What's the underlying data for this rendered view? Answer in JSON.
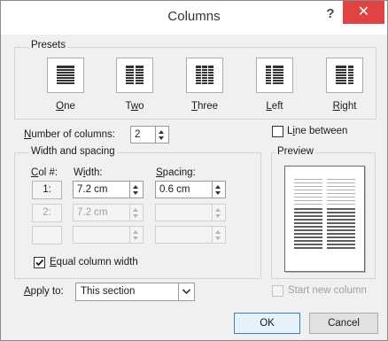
{
  "window": {
    "title": "Columns",
    "help_glyph": "?",
    "close_glyph": "✕"
  },
  "presets": {
    "label": "Presets",
    "items": [
      {
        "key": "O",
        "rest": "ne"
      },
      {
        "key": "w",
        "pre": "T",
        "rest": "o"
      },
      {
        "key": "T",
        "rest": "hree"
      },
      {
        "key": "L",
        "rest": "eft"
      },
      {
        "key": "R",
        "rest": "ight"
      }
    ]
  },
  "number_of_columns": {
    "label_key": "N",
    "label_rest": "umber of columns:",
    "value": "2"
  },
  "line_between": {
    "label_pre": "L",
    "label_key": "i",
    "label_rest": "ne between",
    "checked": false
  },
  "width_spacing": {
    "label": "Width and spacing",
    "col_header_key": "C",
    "col_header_rest": "ol #:",
    "width_header_key": "i",
    "width_header_pre": "W",
    "width_header_rest": "dth:",
    "spacing_header_key": "S",
    "spacing_header_rest": "pacing:",
    "rows": [
      {
        "col": "1:",
        "width": "7.2 cm",
        "spacing": "0.6 cm"
      },
      {
        "col": "2:",
        "width": "7.2 cm",
        "spacing": ""
      },
      {
        "col": "",
        "width": "",
        "spacing": ""
      }
    ]
  },
  "equal_width": {
    "label_key": "E",
    "label_rest": "qual column width",
    "checked": true
  },
  "preview": {
    "label": "Preview",
    "columns": 2
  },
  "apply_to": {
    "label_key": "A",
    "label_rest": "pply to:",
    "value": "This section"
  },
  "start_new_column": {
    "label": "Start new column",
    "checked": false
  },
  "buttons": {
    "ok": "OK",
    "cancel": "Cancel"
  },
  "colors": {
    "close_bg": "#e04343",
    "dialog_bg": "#f0f0f0",
    "default_button_border": "#3c7fb1"
  }
}
